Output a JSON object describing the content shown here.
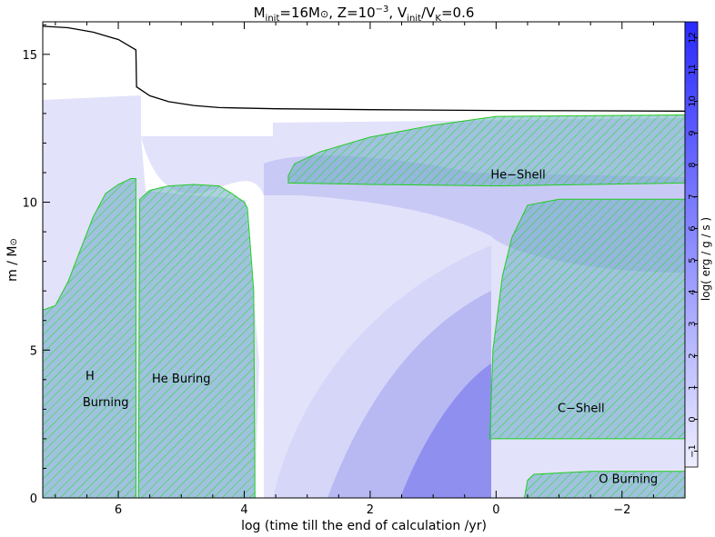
{
  "chart_data": {
    "type": "heatmap",
    "title_parts": {
      "m": "M",
      "m_sub": "init",
      "m_val": "=16M",
      "sun": "⊙",
      "z": ",  Z=10",
      "z_sup": "−3",
      "v": ",  V",
      "v_sub": "init",
      "slash": "/V",
      "k_sub": "K",
      "v_val": "=0.6"
    },
    "xlabel": "log (time till the end of calculation /yr)",
    "ylabel_parts": {
      "m": "m / M",
      "sun": "⊙"
    },
    "colorbar_label": "log( erg / g / s )",
    "x_axis": {
      "min": 7.2,
      "max": -3.0,
      "reversed": true,
      "ticks": [
        6,
        4,
        2,
        0,
        -2
      ],
      "tick_labels": [
        "6",
        "4",
        "2",
        "0",
        "−2"
      ]
    },
    "y_axis": {
      "min": 0,
      "max": 16.1,
      "ticks": [
        0,
        5,
        10,
        15
      ],
      "tick_labels": [
        "0",
        "5",
        "10",
        "15"
      ]
    },
    "colorbar": {
      "min": -1.5,
      "max": 12.5,
      "ticks": [
        -1,
        0,
        1,
        2,
        3,
        4,
        5,
        6,
        7,
        8,
        9,
        10,
        11,
        12
      ],
      "tick_labels": [
        "−1",
        "0",
        "1",
        "2",
        "3",
        "4",
        "5",
        "6",
        "7",
        "8",
        "9",
        "10",
        "11",
        "12"
      ],
      "colors": {
        "low": "#eeeeff",
        "high": "#2a2aff"
      }
    },
    "annotations": [
      {
        "text": "H",
        "x": 6.45,
        "y": 4.0
      },
      {
        "text": "Burning",
        "x": 6.2,
        "y": 3.1
      },
      {
        "text": "He Buring",
        "x": 5.0,
        "y": 3.9
      },
      {
        "text": "He−Shell",
        "x": -0.35,
        "y": 10.8
      },
      {
        "text": "C−Shell",
        "x": -1.35,
        "y": 2.9
      },
      {
        "text": "O Burning",
        "x": -2.1,
        "y": 0.5
      }
    ],
    "total_mass_curve": [
      [
        7.2,
        15.95
      ],
      [
        6.8,
        15.9
      ],
      [
        6.4,
        15.75
      ],
      [
        6.0,
        15.5
      ],
      [
        5.72,
        15.15
      ],
      [
        5.71,
        13.9
      ],
      [
        5.5,
        13.6
      ],
      [
        5.2,
        13.4
      ],
      [
        4.8,
        13.27
      ],
      [
        4.4,
        13.2
      ],
      [
        3.5,
        13.16
      ],
      [
        2.0,
        13.13
      ],
      [
        0,
        13.1
      ],
      [
        -3.0,
        13.08
      ]
    ],
    "convective_zones": [
      {
        "name": "H core",
        "boundary": [
          [
            7.2,
            0
          ],
          [
            7.2,
            6.35
          ],
          [
            7.0,
            6.5
          ],
          [
            6.8,
            7.3
          ],
          [
            6.6,
            8.4
          ],
          [
            6.4,
            9.5
          ],
          [
            6.2,
            10.3
          ],
          [
            6.0,
            10.6
          ],
          [
            5.8,
            10.8
          ],
          [
            5.72,
            10.8
          ],
          [
            5.72,
            0
          ]
        ]
      },
      {
        "name": "He core",
        "boundary": [
          [
            5.68,
            0
          ],
          [
            5.66,
            10.1
          ],
          [
            5.5,
            10.4
          ],
          [
            5.2,
            10.55
          ],
          [
            4.8,
            10.6
          ],
          [
            4.4,
            10.55
          ],
          [
            4.2,
            10.3
          ],
          [
            4.0,
            10.0
          ],
          [
            3.95,
            9.8
          ],
          [
            3.85,
            7.0
          ],
          [
            3.83,
            0
          ]
        ]
      },
      {
        "name": "He shell",
        "boundary": [
          [
            3.3,
            10.9
          ],
          [
            3.2,
            11.3
          ],
          [
            2.8,
            11.7
          ],
          [
            2.0,
            12.2
          ],
          [
            1.0,
            12.6
          ],
          [
            0,
            12.9
          ],
          [
            -3.0,
            12.95
          ],
          [
            -3.0,
            10.65
          ],
          [
            0,
            10.55
          ],
          [
            2.0,
            10.6
          ],
          [
            3.3,
            10.65
          ]
        ]
      },
      {
        "name": "C shell",
        "boundary": [
          [
            0.1,
            2.0
          ],
          [
            0.05,
            5.0
          ],
          [
            -0.1,
            7.5
          ],
          [
            -0.25,
            8.8
          ],
          [
            -0.5,
            9.9
          ],
          [
            -1.0,
            10.1
          ],
          [
            -3.0,
            10.1
          ],
          [
            -3.0,
            2.0
          ]
        ]
      },
      {
        "name": "O core",
        "boundary": [
          [
            -0.45,
            0
          ],
          [
            -0.5,
            0.6
          ],
          [
            -0.6,
            0.8
          ],
          [
            -1.5,
            0.9
          ],
          [
            -3.0,
            0.9
          ],
          [
            -3.0,
            0
          ]
        ]
      }
    ],
    "grid": false,
    "legend": "none"
  }
}
